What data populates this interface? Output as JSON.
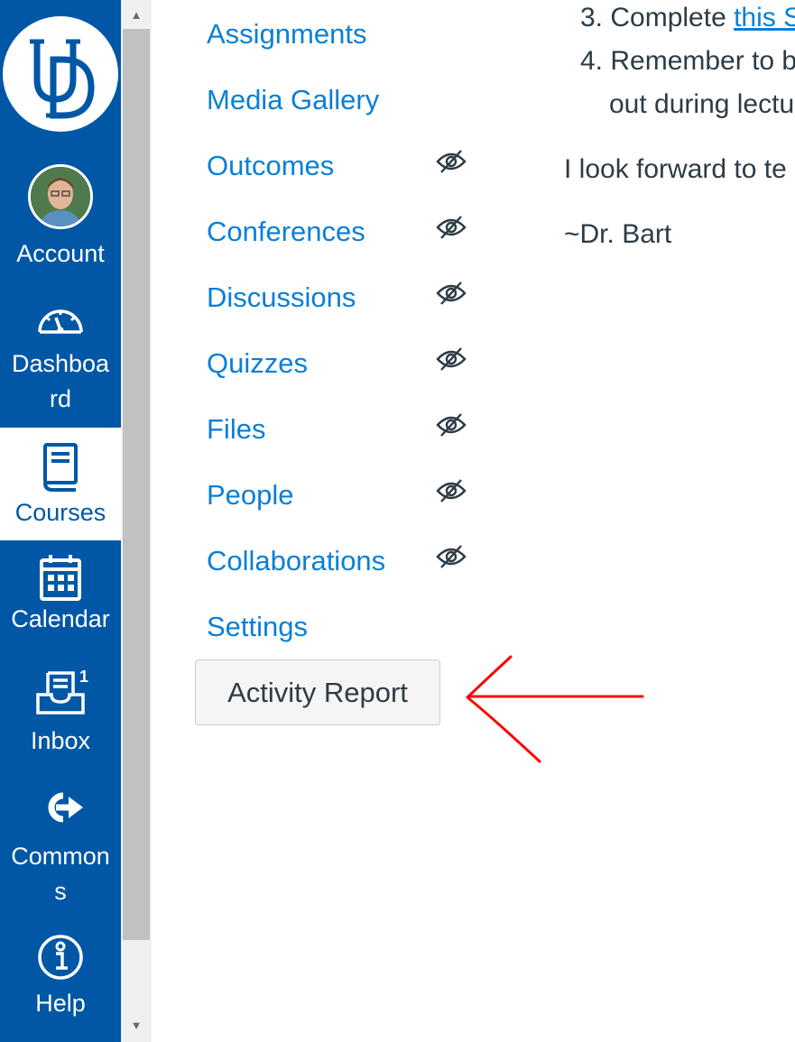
{
  "global_nav": {
    "logo": "UD",
    "items": [
      {
        "label": "Account",
        "icon": "avatar"
      },
      {
        "label": "Dashboa rd",
        "label_lines": [
          "Dashboa",
          "rd"
        ],
        "icon": "dashboard-icon"
      },
      {
        "label": "Courses",
        "icon": "courses-icon",
        "active": true
      },
      {
        "label": "Calendar",
        "icon": "calendar-icon"
      },
      {
        "label": "Inbox",
        "icon": "inbox-icon",
        "badge": "1"
      },
      {
        "label_lines": [
          "Common",
          "s"
        ],
        "icon": "commons-icon"
      },
      {
        "label": "Help",
        "icon": "help-icon"
      }
    ]
  },
  "course_nav": {
    "items": [
      {
        "label": "Assignments",
        "hidden": false
      },
      {
        "label": "Media Gallery",
        "hidden": false
      },
      {
        "label": "Outcomes",
        "hidden": true
      },
      {
        "label": "Conferences",
        "hidden": true
      },
      {
        "label": "Discussions",
        "hidden": true
      },
      {
        "label": "Quizzes",
        "hidden": true
      },
      {
        "label": "Files",
        "hidden": true
      },
      {
        "label": "People",
        "hidden": true
      },
      {
        "label": "Collaborations",
        "hidden": true
      },
      {
        "label": "Settings",
        "hidden": false
      }
    ],
    "activity_report_label": "Activity Report"
  },
  "content": {
    "item3_prefix": "3. Complete ",
    "item3_link": "this S",
    "item4_line1": "4. Remember to b",
    "item4_line2": "out during lectu",
    "paragraph": "I look forward to te",
    "signature": "~Dr. Bart"
  },
  "colors": {
    "nav_bg": "#0057a6",
    "link": "#0a7fd6",
    "text": "#2d3b45",
    "annotation": "#ff0000"
  }
}
